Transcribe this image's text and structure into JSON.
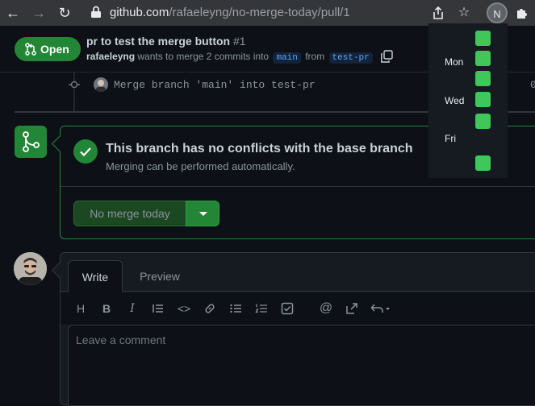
{
  "browser": {
    "url_host": "github.com",
    "url_path": "/rafaeleyng/no-merge-today/pull/1",
    "profile_initial": "N"
  },
  "pr": {
    "state_label": "Open",
    "title": "pr to test the merge button",
    "number": "#1",
    "author": "rafaeleyng",
    "meta_text": "wants to merge 2 commits into",
    "base_branch": "main",
    "from_text": "from",
    "head_branch": "test-pr"
  },
  "timeline": {
    "commit_message": "Merge branch 'main' into test-pr",
    "commit_trailing": "0"
  },
  "merge_box": {
    "status_title": "This branch has no conflicts with the base branch",
    "status_subtitle": "Merging can be performed automatically.",
    "merge_button_label": "No merge today"
  },
  "comment": {
    "tab_write": "Write",
    "tab_preview": "Preview",
    "placeholder": "Leave a comment",
    "toolbar": [
      "heading-icon",
      "bold-icon",
      "italic-icon",
      "quote-icon",
      "code-icon",
      "link-icon",
      "unordered-list-icon",
      "ordered-list-icon",
      "task-list-icon",
      "mention-icon",
      "reference-icon",
      "reply-icon"
    ]
  },
  "contribution_popover": {
    "day_labels": [
      "Mon",
      "Wed",
      "Fri"
    ],
    "cells": [
      "#3fc75a",
      "#3fc75a",
      "#3fc75a",
      "#3fc75a",
      "#3fc75a",
      "#161b22",
      "#3fc75a"
    ]
  },
  "colors": {
    "accent_green": "#238636",
    "link_blue": "#58a6ff",
    "background": "#0d1117"
  }
}
